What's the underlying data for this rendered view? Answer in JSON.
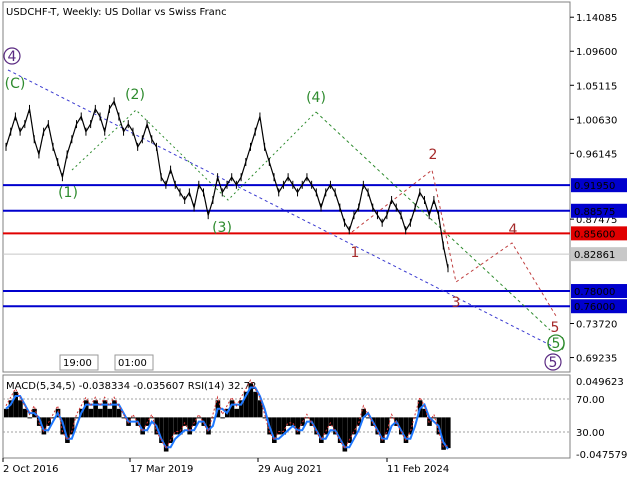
{
  "chart_data": {
    "type": "line",
    "title": "USDCHF-T, Weekly:  US Dollar vs Swiss Franc",
    "symbol": "USDCHF-T",
    "timeframe": "Weekly",
    "description": "US Dollar vs Swiss Franc",
    "ylim": [
      0.6733,
      1.1609
    ],
    "price_ticks": [
      "1.14085",
      "1.09600",
      "1.05115",
      "1.00630",
      "0.96145",
      "0.91950",
      "0.88575",
      "0.87475",
      "0.85600",
      "0.82861",
      "0.78000",
      "0.76000",
      "0.73720",
      "0.69235"
    ],
    "time_labels": [
      "2 Oct 2016",
      "17 Mar 2019",
      "29 Aug 2021",
      "11 Feb 2024"
    ],
    "session_labels": [
      "19:00",
      "01:00"
    ],
    "levels": [
      {
        "value": "0.91950",
        "color": "#0000cd",
        "label_bg": "#0000cd"
      },
      {
        "value": "0.88575",
        "color": "#0000cd",
        "label_bg": "#0000cd"
      },
      {
        "value": "0.85600",
        "color": "#e00000",
        "label_bg": "#e00000"
      },
      {
        "value": "0.82861",
        "color": "#c8c8c8",
        "label_bg": "#c8c8c8"
      },
      {
        "value": "0.78000",
        "color": "#0000cd",
        "label_bg": "#0000cd"
      },
      {
        "value": "0.76000",
        "color": "#0000cd",
        "label_bg": "#0000cd"
      }
    ],
    "price_series": [
      0.97,
      0.99,
      1.01,
      0.99,
      1.0,
      1.02,
      0.98,
      0.96,
      0.99,
      1.0,
      0.97,
      0.95,
      0.93,
      0.96,
      0.98,
      1.0,
      1.01,
      0.99,
      1.0,
      1.02,
      1.01,
      0.99,
      1.02,
      1.03,
      1.01,
      0.99,
      1.0,
      0.99,
      0.97,
      0.98,
      1.0,
      0.98,
      0.97,
      0.93,
      0.92,
      0.94,
      0.92,
      0.91,
      0.9,
      0.91,
      0.89,
      0.92,
      0.91,
      0.88,
      0.9,
      0.93,
      0.91,
      0.92,
      0.93,
      0.92,
      0.93,
      0.95,
      0.97,
      0.99,
      1.01,
      0.97,
      0.95,
      0.93,
      0.91,
      0.92,
      0.93,
      0.92,
      0.91,
      0.92,
      0.93,
      0.92,
      0.91,
      0.89,
      0.91,
      0.92,
      0.91,
      0.89,
      0.87,
      0.86,
      0.88,
      0.89,
      0.92,
      0.91,
      0.89,
      0.88,
      0.87,
      0.88,
      0.9,
      0.89,
      0.88,
      0.86,
      0.87,
      0.89,
      0.91,
      0.9,
      0.88,
      0.9,
      0.88,
      0.84,
      0.81
    ],
    "waves": [
      {
        "label": "4",
        "group": "purple",
        "circled": true
      },
      {
        "label": "(C)",
        "group": "green"
      },
      {
        "label": "(1)",
        "group": "green"
      },
      {
        "label": "(2)",
        "group": "green"
      },
      {
        "label": "(3)",
        "group": "green"
      },
      {
        "label": "(4)",
        "group": "green"
      },
      {
        "label": "(5)",
        "group": "green",
        "circled": true
      },
      {
        "label": "1",
        "group": "red"
      },
      {
        "label": "2",
        "group": "red"
      },
      {
        "label": "3",
        "group": "red"
      },
      {
        "label": "4",
        "group": "red"
      },
      {
        "label": "5",
        "group": "red"
      },
      {
        "label": "5",
        "group": "purple",
        "circled": true
      }
    ]
  },
  "indicator": {
    "title": "MACD(5,34,5) -0.038334 -0.035607 RSI(14) 32.72",
    "ticks": [
      "0.049623",
      "70.00",
      "30.00",
      "-0.047579"
    ],
    "ylim": [
      -0.047579,
      0.049623
    ],
    "macd": [
      0.01,
      0.02,
      0.03,
      0.02,
      0.01,
      0.0,
      0.01,
      -0.01,
      -0.02,
      -0.01,
      0.0,
      0.01,
      -0.02,
      -0.03,
      -0.02,
      0.0,
      0.01,
      0.02,
      0.01,
      0.02,
      0.01,
      0.02,
      0.01,
      0.02,
      0.01,
      0.0,
      -0.01,
      0.0,
      -0.01,
      -0.02,
      -0.01,
      0.0,
      -0.02,
      -0.03,
      -0.04,
      -0.03,
      -0.02,
      -0.02,
      -0.01,
      -0.02,
      -0.01,
      0.0,
      -0.01,
      -0.02,
      0.0,
      0.02,
      0.0,
      0.01,
      0.02,
      0.01,
      0.02,
      0.03,
      0.04,
      0.03,
      0.02,
      0.0,
      -0.02,
      -0.03,
      -0.02,
      -0.02,
      -0.01,
      -0.01,
      -0.02,
      -0.01,
      0.0,
      -0.01,
      -0.02,
      -0.03,
      -0.02,
      -0.01,
      -0.02,
      -0.03,
      -0.04,
      -0.03,
      -0.02,
      -0.01,
      0.01,
      0.0,
      -0.01,
      -0.02,
      -0.03,
      -0.02,
      0.0,
      -0.01,
      -0.02,
      -0.03,
      -0.02,
      0.0,
      0.02,
      0.01,
      -0.01,
      0.0,
      -0.02,
      -0.038,
      -0.036
    ]
  }
}
